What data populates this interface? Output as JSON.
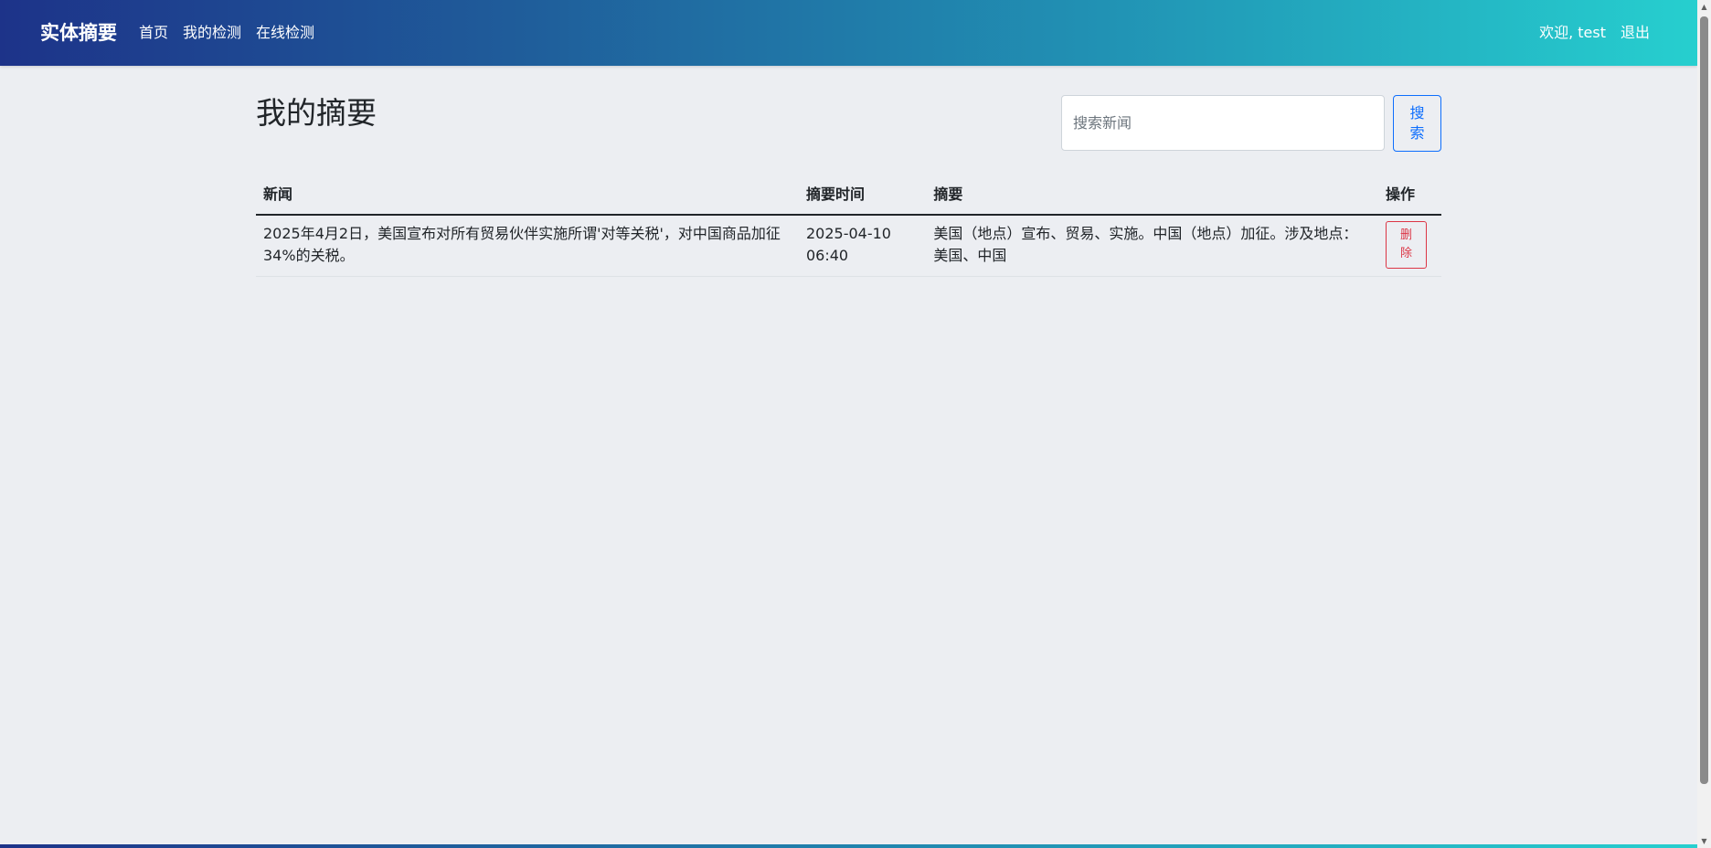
{
  "nav": {
    "brand": "实体摘要",
    "links": [
      "首页",
      "我的检测",
      "在线检测"
    ],
    "welcome": "欢迎, test",
    "logout": "退出"
  },
  "page": {
    "title": "我的摘要"
  },
  "search": {
    "placeholder": "搜索新闻",
    "value": "",
    "button_label": "搜索"
  },
  "table": {
    "headers": [
      "新闻",
      "摘要时间",
      "摘要",
      "操作"
    ],
    "rows": [
      {
        "news": "2025年4月2日，美国宣布对所有贸易伙伴实施所谓'对等关税'，对中国商品加征34%的关税。",
        "time": "2025-04-10 06:40",
        "summary": "美国（地点）宣布、贸易、实施。中国（地点）加征。涉及地点：美国、中国",
        "action": "删除"
      }
    ]
  },
  "colors": {
    "nav_gradient_start": "#1d3389",
    "nav_gradient_end": "#26cfcf",
    "primary": "#0d6efd",
    "danger": "#dc3545",
    "background": "#eceef2"
  },
  "icons": {
    "scroll_up": "triangle-up-icon",
    "scroll_down": "triangle-down-icon"
  }
}
